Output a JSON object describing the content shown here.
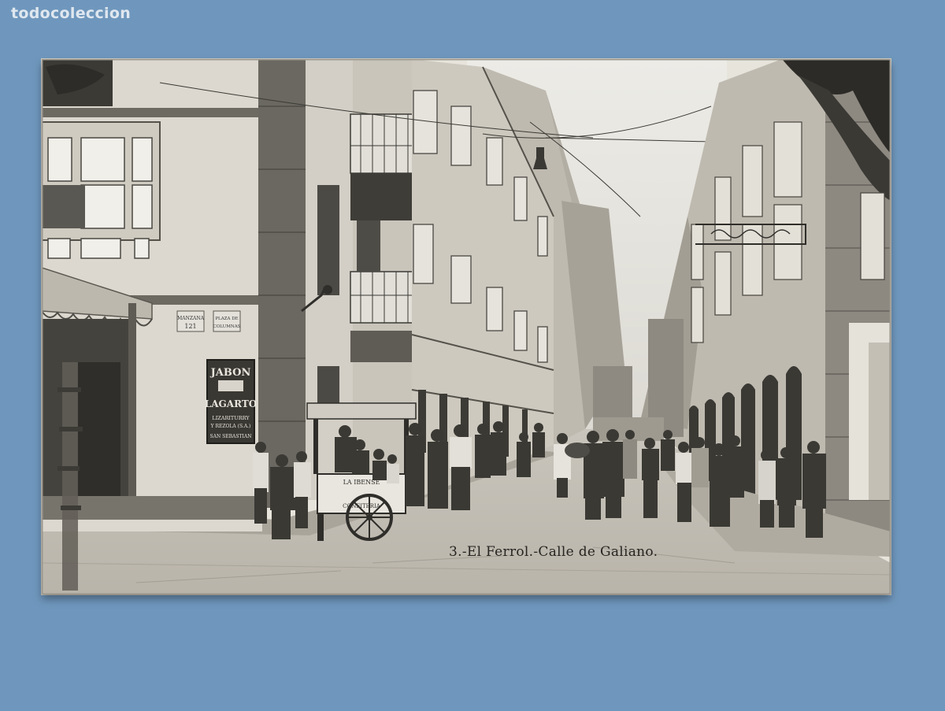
{
  "watermark": {
    "text": "todocoleccion"
  },
  "postcard": {
    "caption": "3.-El Ferrol.-Calle de Galiano.",
    "shop_sign": {
      "line1": "JABON",
      "line2": "LAGARTO",
      "line3": "LIZARITURRY",
      "line4": "Y REZOLA (S.A.)",
      "line5": "SAN SEBASTIAN"
    },
    "cart_sign": {
      "top": "LA IBENSE",
      "bottom": "CONFITERIA"
    },
    "wall_plaques": {
      "left": "MANZANA 121",
      "right": "PLAZA DE COLUMNAS"
    }
  },
  "colors": {
    "background": "#6f97bd",
    "postcard_paper": "#e7e4dc",
    "ink": "#262420"
  }
}
